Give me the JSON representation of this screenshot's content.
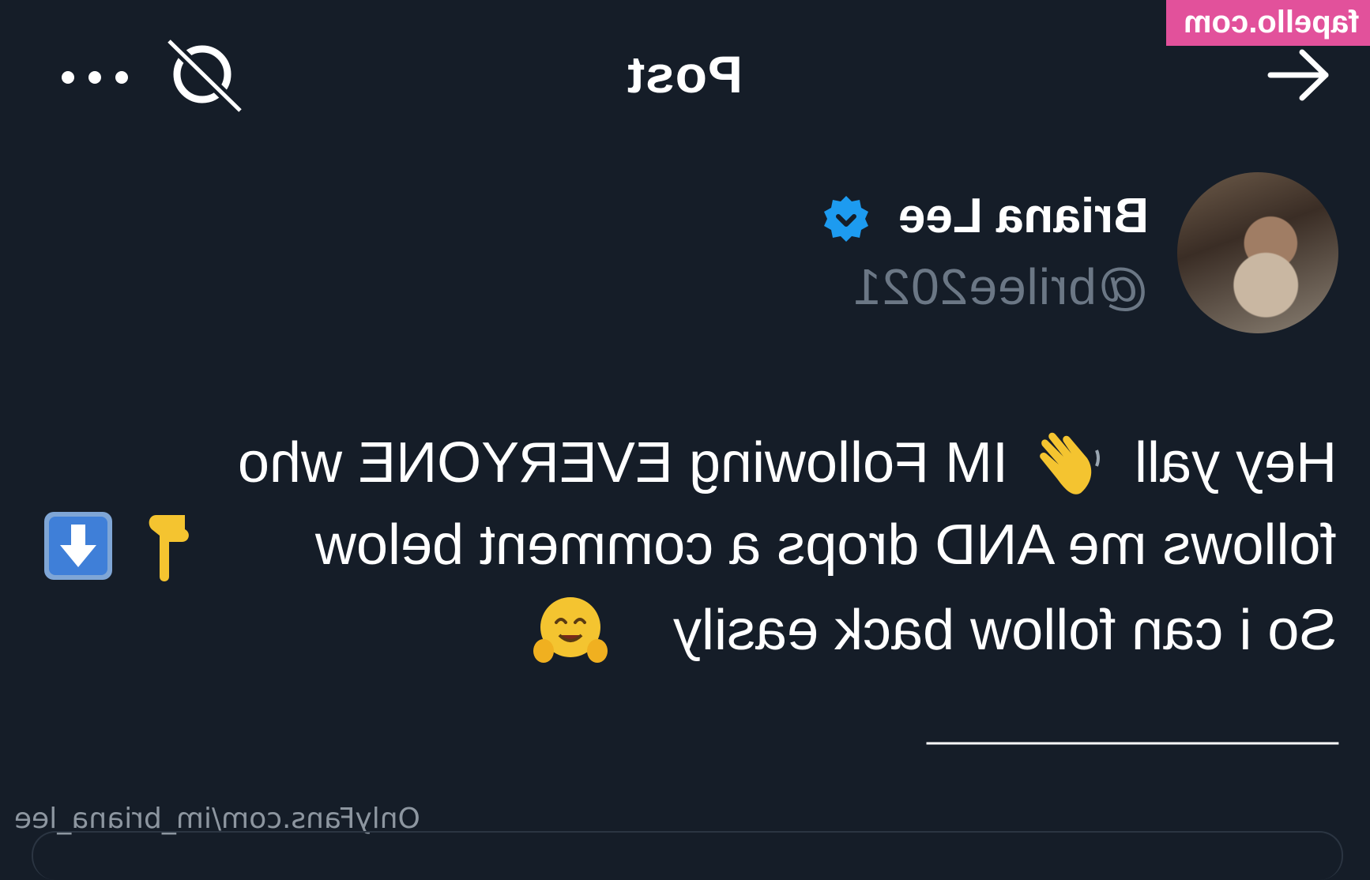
{
  "watermark": {
    "text": "fapello.com"
  },
  "header": {
    "title": "Post",
    "icons": {
      "more": "more-dots-icon",
      "grok": "grok-icon",
      "back": "arrow-back-icon"
    }
  },
  "author": {
    "name": "Briana Lee",
    "handle": "@brilee2021",
    "verified_icon": "verified-badge-icon",
    "verified_color": "#1d9bf0"
  },
  "post": {
    "lines": [
      "Hey yall",
      "IM Following EVERYONE who",
      "follows me AND drops a comment below",
      "So i can follow back easily"
    ],
    "emojis": [
      "👋",
      "👇",
      "⬇️",
      "🤗"
    ],
    "separator": "_____________________",
    "link": "OnlyFans.com/im_briana_lee"
  },
  "colors": {
    "background": "#151d28",
    "text": "#ffffff",
    "muted": "#6b7785",
    "watermark_bg": "#e2519b"
  }
}
